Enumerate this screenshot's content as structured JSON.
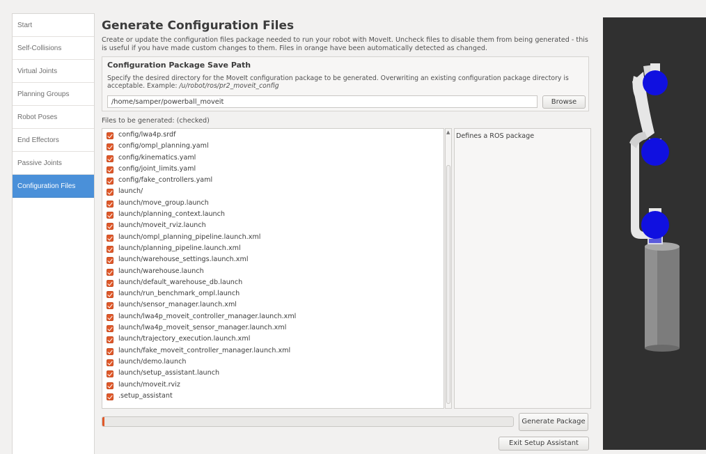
{
  "sidebar": {
    "items": [
      {
        "label": "Start",
        "active": false
      },
      {
        "label": "Self-Collisions",
        "active": false
      },
      {
        "label": "Virtual Joints",
        "active": false
      },
      {
        "label": "Planning Groups",
        "active": false
      },
      {
        "label": "Robot Poses",
        "active": false
      },
      {
        "label": "End Effectors",
        "active": false
      },
      {
        "label": "Passive Joints",
        "active": false
      },
      {
        "label": "Configuration Files",
        "active": true
      }
    ]
  },
  "main": {
    "title": "Generate Configuration Files",
    "description": "Create or update the configuration files package needed to run your robot with MoveIt. Uncheck files to disable them from being generated - this is useful if you have made custom changes to them. Files in orange have been automatically detected as changed.",
    "save_path": {
      "title": "Configuration Package Save Path",
      "description": "Specify the desired directory for the MoveIt configuration package to be generated. Overwriting an existing configuration package directory is acceptable. Example: ",
      "example": "/u/robot/ros/pr2_moveit_config",
      "value": "/home/samper/powerball_moveit",
      "browse_label": "Browse"
    },
    "files_label": "Files to be generated: (checked)",
    "files": [
      "config/lwa4p.srdf",
      "config/ompl_planning.yaml",
      "config/kinematics.yaml",
      "config/joint_limits.yaml",
      "config/fake_controllers.yaml",
      "launch/",
      "launch/move_group.launch",
      "launch/planning_context.launch",
      "launch/moveit_rviz.launch",
      "launch/ompl_planning_pipeline.launch.xml",
      "launch/planning_pipeline.launch.xml",
      "launch/warehouse_settings.launch.xml",
      "launch/warehouse.launch",
      "launch/default_warehouse_db.launch",
      "launch/run_benchmark_ompl.launch",
      "launch/sensor_manager.launch.xml",
      "launch/lwa4p_moveit_controller_manager.launch.xml",
      "launch/lwa4p_moveit_sensor_manager.launch.xml",
      "launch/trajectory_execution.launch.xml",
      "launch/fake_moveit_controller_manager.launch.xml",
      "launch/demo.launch",
      "launch/setup_assistant.launch",
      "launch/moveit.rviz",
      ".setup_assistant"
    ],
    "file_description": "Defines a ROS package",
    "progress": 0.005,
    "generate_label": "Generate Package",
    "exit_label": "Exit Setup Assistant"
  },
  "colors": {
    "accent": "#4a90d9",
    "checkbox": "#e0592a",
    "viewer_background": "#303030",
    "robot_link": "#e8e8e8",
    "robot_joint": "#1010e0"
  },
  "icons": {
    "checkbox": "checkbox-checked-icon",
    "scroll_up": "scroll-up-arrow-icon"
  }
}
